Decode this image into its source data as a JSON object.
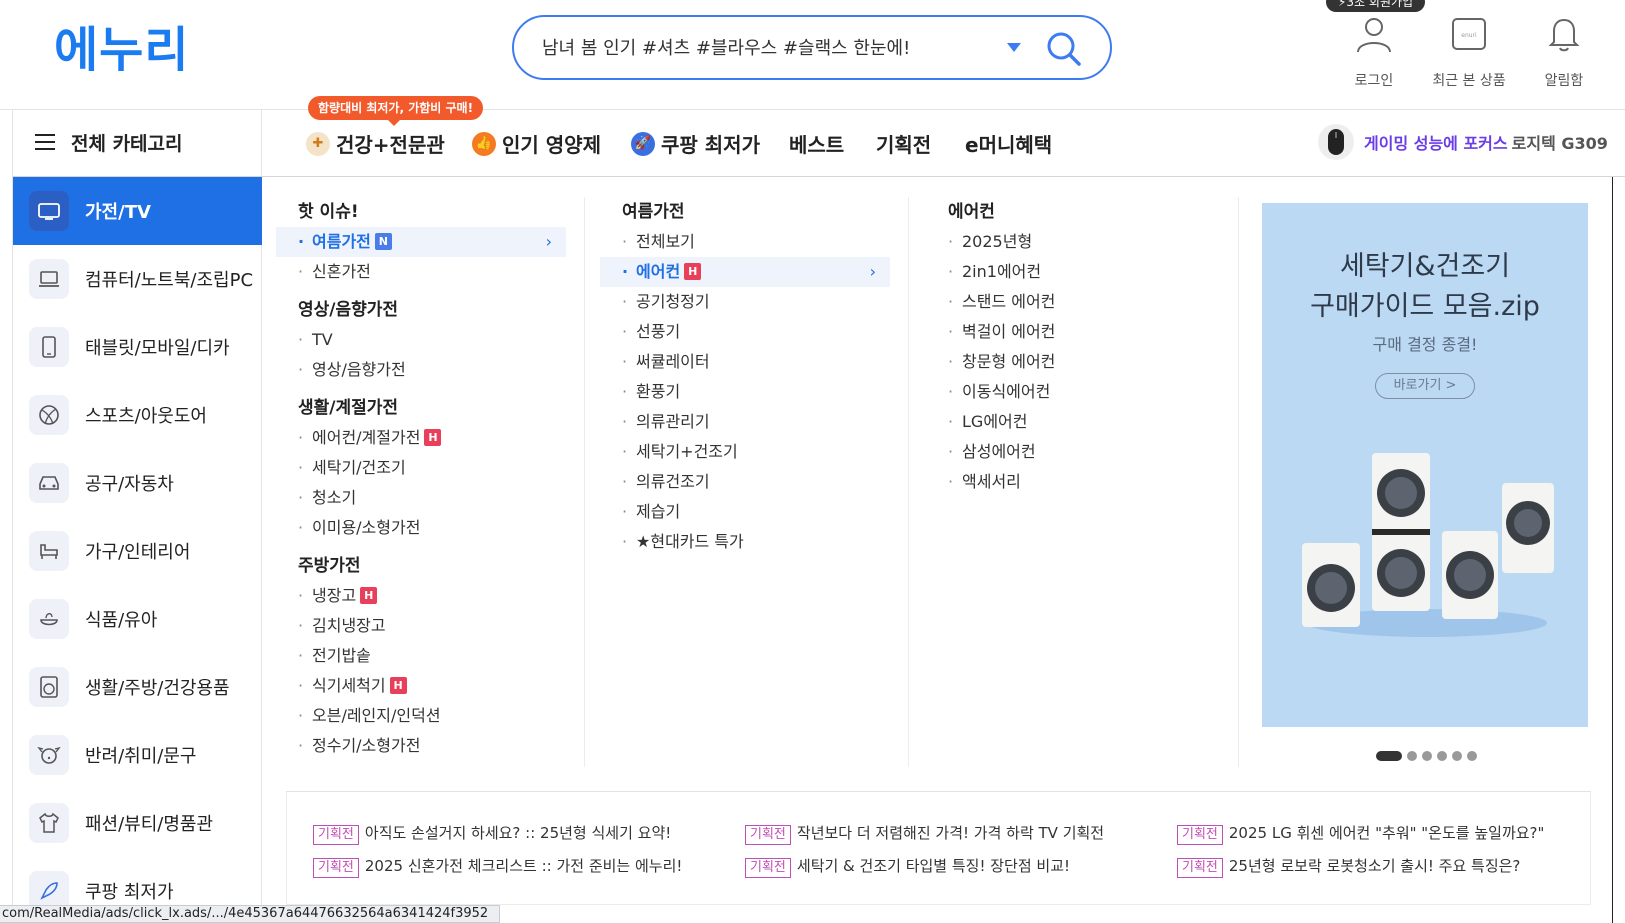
{
  "header": {
    "logo": "에누리",
    "search_placeholder": "남녀 봄 인기 #셔츠 #블라우스 #슬랙스 한눈에!",
    "tooltip": "⚡3초 회원가입",
    "login": "로그인",
    "recent": "최근 본 상품",
    "recent_icon_text": "enuri",
    "alarm": "알림함"
  },
  "nav": {
    "all_category": "전체 카테고리",
    "promo_badge": "함량대비 최저가, 가함비 구매!",
    "items": [
      "건강+전문관",
      "인기 영양제",
      "쿠팡 최저가",
      "베스트",
      "기획전",
      "e머니혜택"
    ],
    "ad_highlight": "게이밍 성능에 포커스",
    "ad_product": "로지텍 G309"
  },
  "sidebar": {
    "items": [
      "가전/TV",
      "컴퓨터/노트북/조립PC",
      "태블릿/모바일/디카",
      "스포츠/아웃도어",
      "공구/자동차",
      "가구/인테리어",
      "식품/유아",
      "생활/주방/건강용품",
      "반려/취미/문구",
      "패션/뷰티/명품관",
      "쿠팡 최저가"
    ]
  },
  "col1": {
    "hot_title": "핫 이슈!",
    "hot_items": [
      "여름가전",
      "신혼가전"
    ],
    "av_title": "영상/음향가전",
    "av_items": [
      "TV",
      "영상/음향가전"
    ],
    "life_title": "생활/계절가전",
    "life_items": [
      "에어컨/계절가전",
      "세탁기/건조기",
      "청소기",
      "이미용/소형가전"
    ],
    "kitchen_title": "주방가전",
    "kitchen_items": [
      "냉장고",
      "김치냉장고",
      "전기밥솥",
      "식기세척기",
      "오븐/레인지/인덕션",
      "정수기/소형가전"
    ]
  },
  "col2": {
    "title": "여름가전",
    "items": [
      "전체보기",
      "에어컨",
      "공기청정기",
      "선풍기",
      "써큘레이터",
      "환풍기",
      "의류관리기",
      "세탁기+건조기",
      "의류건조기",
      "제습기",
      "★현대카드 특가"
    ]
  },
  "col3": {
    "title": "에어컨",
    "items": [
      "2025년형",
      "2in1에어컨",
      "스탠드 에어컨",
      "벽걸이 에어컨",
      "창문형 에어컨",
      "이동식에어컨",
      "LG에어컨",
      "삼성에어컨",
      "액세서리"
    ]
  },
  "tags": {
    "new": "N",
    "hot": "H"
  },
  "banner": {
    "line1": "세탁기&건조기",
    "line2": "구매가이드 모음.zip",
    "sub": "구매 결정 종결!",
    "button": "바로가기 >"
  },
  "promo_links": {
    "tag": "기획전",
    "items": [
      "아직도 손설거지 하세요? :: 25년형 식세기 요약!",
      "작년보다 더 저렴해진 가격! 가격 하락 TV 기획전",
      "2025 LG 휘센 에어컨 \"추워\" \"온도를 높일까요?\"",
      "2025 신혼가전 체크리스트 :: 가전 준비는 에누리!",
      "세탁기 & 건조기 타입별 특징! 장단점 비교!",
      "25년형 로보락 로봇청소기 출시! 주요 특징은?"
    ]
  },
  "status_url": "com/RealMedia/ads/click_lx.ads/.../4e45367a64476632564a6341424f3952",
  "colors": {
    "brand": "#1a7cf0",
    "active": "#1f6fe5",
    "hot": "#e8405a",
    "new": "#4a7de8",
    "promo": "#c04fb5"
  }
}
